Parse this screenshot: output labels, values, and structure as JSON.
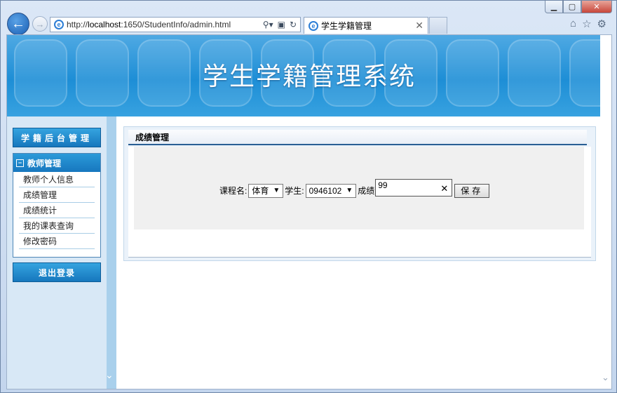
{
  "browser": {
    "url_host": "localhost",
    "url_rest": ":1650/StudentInfo/admin.html",
    "url_prefix": "http://",
    "tab_title": "学生学籍管理"
  },
  "banner": {
    "title": "学生学籍管理系统"
  },
  "sidebar": {
    "header": "学籍后台管理",
    "section_title": "教师管理",
    "items": [
      {
        "label": "教师个人信息"
      },
      {
        "label": "成绩管理"
      },
      {
        "label": "成绩统计"
      },
      {
        "label": "我的课表查询"
      },
      {
        "label": "修改密码"
      }
    ],
    "logout": "退出登录"
  },
  "panel": {
    "title": "成绩管理",
    "course_label": "课程名:",
    "course_value": "体育",
    "student_label": "学生:",
    "student_value": "0946102",
    "score_label": "成绩",
    "score_value": "99",
    "save_label": "保存"
  }
}
